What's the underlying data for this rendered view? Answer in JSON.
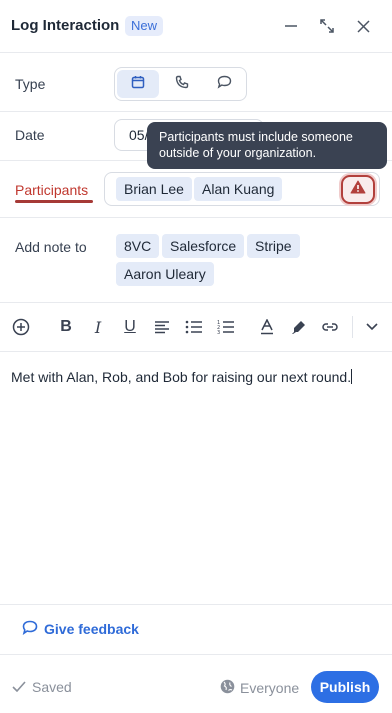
{
  "header": {
    "title": "Log Interaction",
    "badge": "New",
    "icons": [
      "minimize-icon",
      "expand-icon",
      "close-icon"
    ]
  },
  "type_row": {
    "label": "Type",
    "options": [
      "calendar-icon",
      "phone-icon",
      "chat-bubble-icon"
    ],
    "selected": "calendar-icon"
  },
  "date_row": {
    "label": "Date",
    "value": "05/"
  },
  "tooltip": {
    "text_line1": "Participants must include someone",
    "text_line2": "outside of your organization."
  },
  "participants_row": {
    "label": "Participants",
    "chips": [
      "Brian Lee",
      "Alan Kuang"
    ],
    "warning_icon": "warning-triangle-icon",
    "error_color": "#c0372e"
  },
  "add_note_row": {
    "label": "Add note to",
    "chips": [
      "8VC",
      "Salesforce",
      "Stripe",
      "Aaron Uleary"
    ]
  },
  "toolbar": {
    "buttons": [
      "add-circle-icon",
      "bold-icon",
      "italic-icon",
      "underline-icon",
      "align-left-icon",
      "bullet-list-icon",
      "numbered-list-icon",
      "text-color-icon",
      "highlight-icon",
      "link-icon",
      "chevron-down-icon"
    ]
  },
  "editor": {
    "content": "Met with Alan, Rob, and Bob for raising our next round."
  },
  "feedback": {
    "label": "Give feedback"
  },
  "footer": {
    "saved_label": "Saved",
    "visibility_label": "Everyone",
    "publish_label": "Publish",
    "accent_color": "#2d6fe4"
  }
}
